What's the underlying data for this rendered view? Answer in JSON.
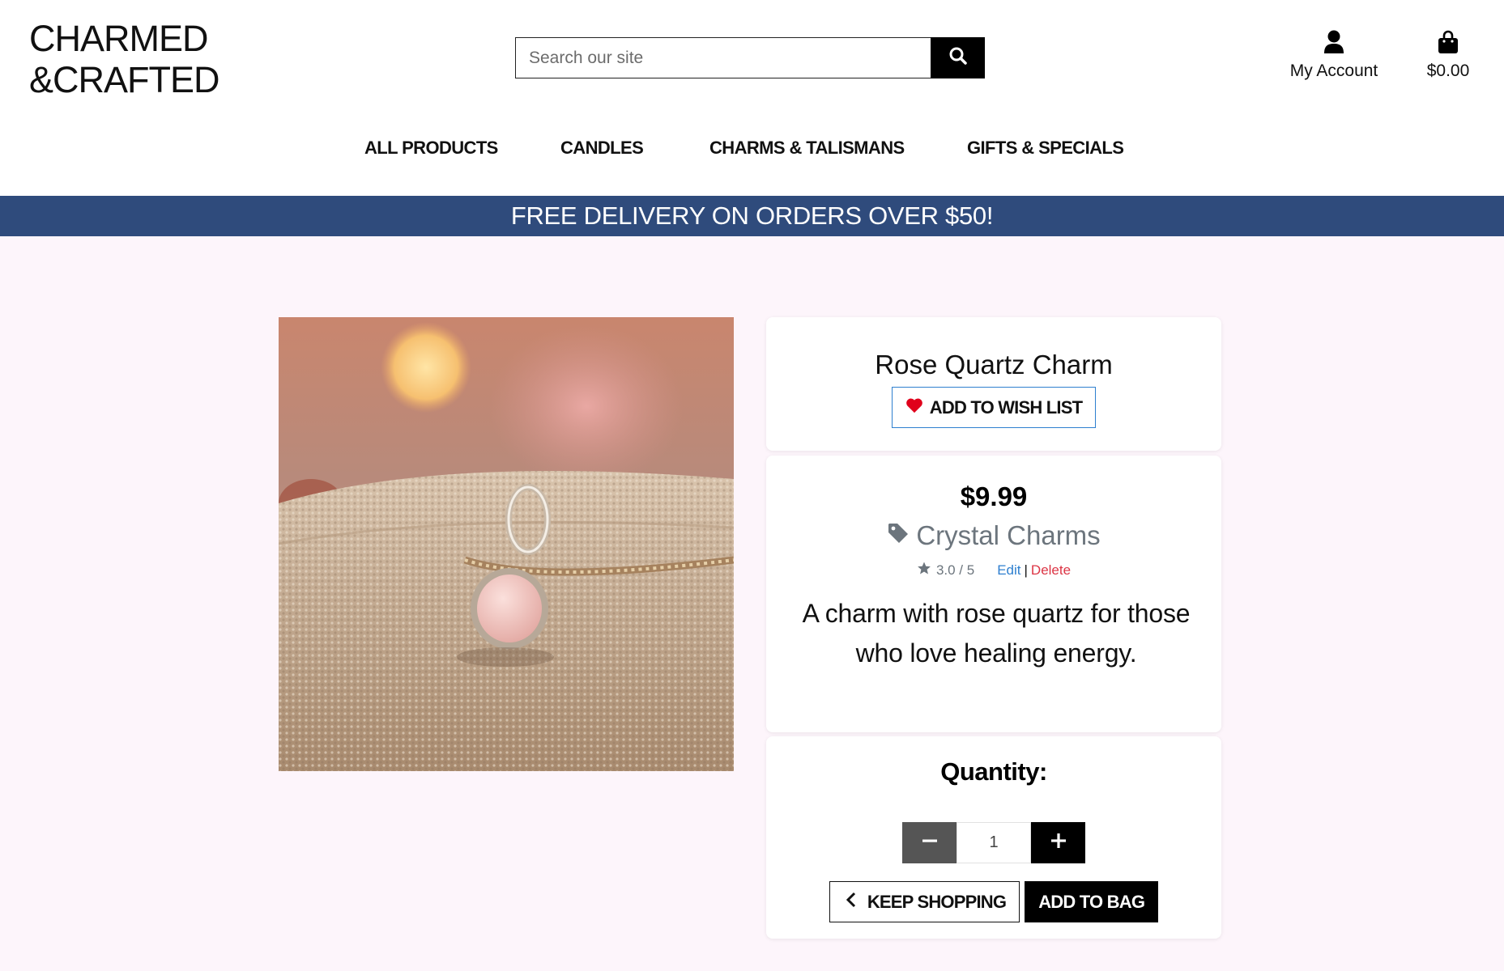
{
  "brand": {
    "line1": "CHARMED",
    "line2": "&CRAFTED"
  },
  "search": {
    "placeholder": "Search our site",
    "icon": "search-icon"
  },
  "header": {
    "account_label": "My Account",
    "account_icon": "user-icon",
    "bag_total": "$0.00",
    "bag_icon": "shopping-bag-icon"
  },
  "nav": {
    "items": [
      {
        "label": "ALL PRODUCTS"
      },
      {
        "label": "CANDLES"
      },
      {
        "label": "CHARMS & TALISMANS"
      },
      {
        "label": "GIFTS & SPECIALS"
      }
    ]
  },
  "banner": {
    "text": "FREE DELIVERY ON ORDERS OVER $50!",
    "color": "#2f4b7c"
  },
  "product": {
    "name": "Rose Quartz Charm",
    "wishlist_label": "ADD TO WISH LIST",
    "price": "$9.99",
    "category": "Crystal Charms",
    "rating": "3.0 / 5",
    "edit_label": "Edit",
    "separator": "|",
    "delete_label": "Delete",
    "description": "A charm with rose quartz for those who love healing energy."
  },
  "quantity": {
    "title": "Quantity:",
    "value": "1"
  },
  "actions": {
    "keep_shopping": "KEEP SHOPPING",
    "add_to_bag": "ADD TO BAG"
  },
  "colors": {
    "accent_blue": "#2e7fcf",
    "delete_red": "#dc3545",
    "heart_red": "#e0001b",
    "muted": "#6c757d",
    "page_bg": "#fdf5fb"
  }
}
